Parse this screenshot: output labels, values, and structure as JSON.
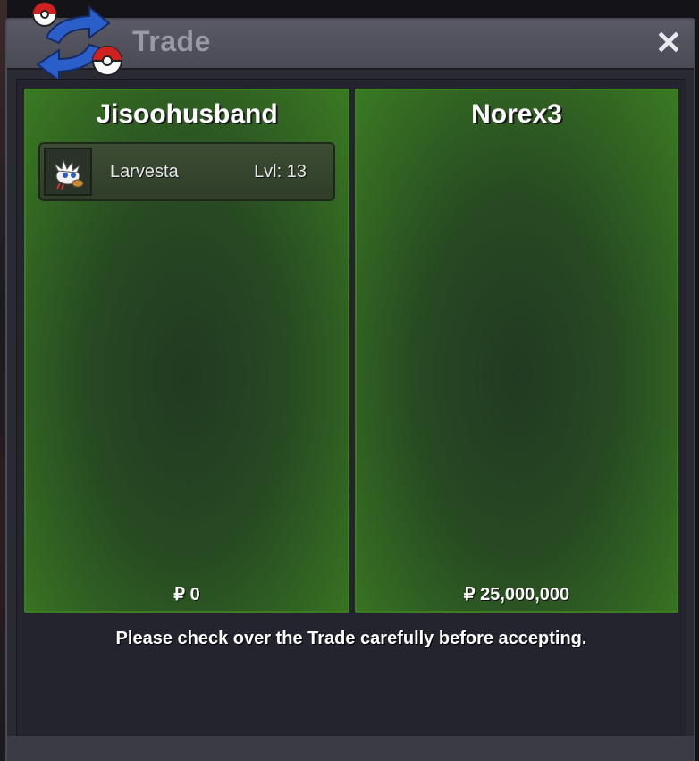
{
  "window": {
    "title": "Trade",
    "close_label": "✕"
  },
  "players": [
    {
      "name": "Jisoohusband",
      "pokemon": [
        {
          "name": "Larvesta",
          "level": "Lvl: 13",
          "icon": "larvesta-icon"
        }
      ],
      "money": "₽ 0"
    },
    {
      "name": "Norex3",
      "pokemon": [],
      "money": "₽ 25,000,000"
    }
  ],
  "notice": "Please check over the Trade carefully before accepting.",
  "colors": {
    "panel_border": "#3a7c1f",
    "panel_green": "#3a7a22",
    "window_bg": "#2a2a33"
  }
}
